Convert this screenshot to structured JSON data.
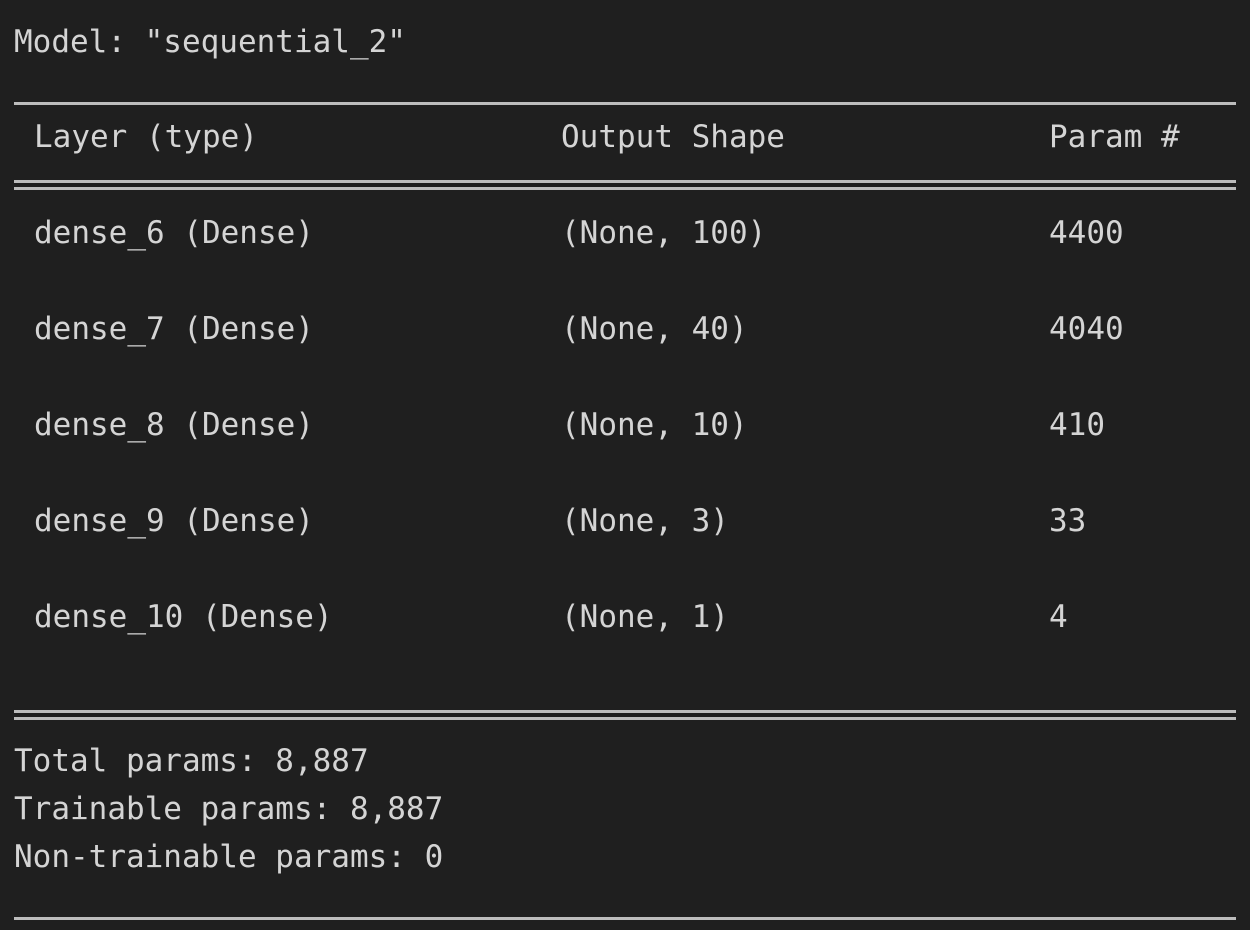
{
  "model_title": "Model: \"sequential_2\"",
  "header": {
    "layer": "Layer (type)",
    "shape": "Output Shape",
    "param": "Param #"
  },
  "rows": [
    {
      "layer": "dense_6 (Dense)",
      "shape": "(None, 100)",
      "param": "4400"
    },
    {
      "layer": "dense_7 (Dense)",
      "shape": "(None, 40)",
      "param": "4040"
    },
    {
      "layer": "dense_8 (Dense)",
      "shape": "(None, 10)",
      "param": "410"
    },
    {
      "layer": "dense_9 (Dense)",
      "shape": "(None, 3)",
      "param": "33"
    },
    {
      "layer": "dense_10 (Dense)",
      "shape": "(None, 1)",
      "param": "4"
    }
  ],
  "summary": {
    "total": "Total params: 8,887",
    "trainable": "Trainable params: 8,887",
    "non_trainable": "Non-trainable params: 0"
  },
  "colors": {
    "background": "#1f1f1f",
    "text": "#d4d4d4",
    "rule": "#bdbdbd"
  }
}
